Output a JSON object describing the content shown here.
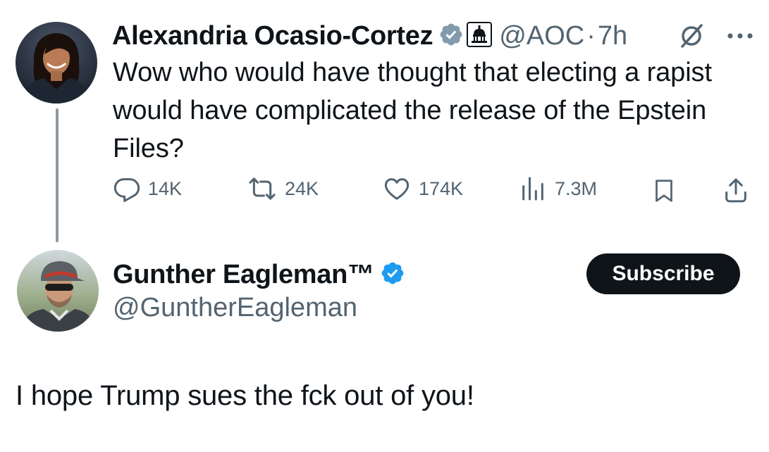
{
  "main_tweet": {
    "author_name": "Alexandria Ocasio-Cortez",
    "handle": "@AOC",
    "separator": "·",
    "time": "7h",
    "text": "Wow who would have thought that electing a rapist would have complicated the release of the Epstein Files?",
    "badges": [
      "verified-gray-badge-icon",
      "capitol-affiliation-icon"
    ],
    "actions": {
      "replies": "14K",
      "reposts": "24K",
      "likes": "174K",
      "views": "7.3M"
    }
  },
  "reply_author": {
    "name": "Gunther Eagleman™",
    "handle": "@GuntherEagleman",
    "subscribe_label": "Subscribe"
  },
  "reply": {
    "text": "I hope Trump sues the fck out of you!"
  },
  "colors": {
    "text": "#0f1419",
    "muted": "#536471",
    "verified_blue": "#1d9bf0",
    "verified_gray": "#829aab",
    "thread_line": "#8f979e"
  }
}
